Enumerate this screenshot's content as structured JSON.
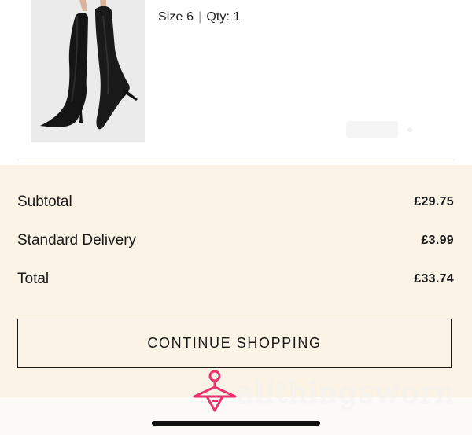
{
  "product": {
    "variant": {
      "size_label": "Size 6",
      "separator": "|",
      "qty_label": "Qty: 1"
    }
  },
  "summary": {
    "subtotal": {
      "label": "Subtotal",
      "amount": "£29.75"
    },
    "delivery": {
      "label": "Standard Delivery",
      "amount": "£3.99"
    },
    "total": {
      "label": "Total",
      "amount": "£33.74"
    }
  },
  "actions": {
    "continue_label": "CONTINUE SHOPPING"
  },
  "watermark": {
    "text": "allthingsworn",
    "logo_color": "#e8336d"
  },
  "colors": {
    "summary_background": "#faf3e6",
    "button_border": "#1a1a1a"
  }
}
